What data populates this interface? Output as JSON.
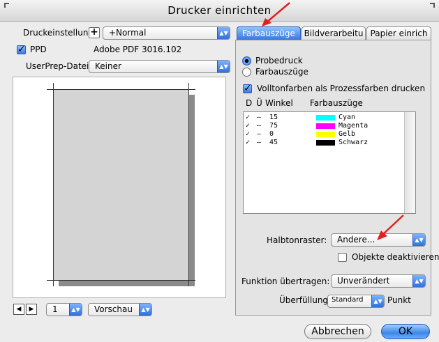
{
  "window": {
    "title": "Drucker einrichten"
  },
  "left": {
    "preset_label": "Druckeinstellung:",
    "preset_value": "+Normal",
    "ppd_label": "PPD",
    "ppd_value": "Adobe PDF 3016.102",
    "ppd_checked": true,
    "userprep_label": "UserPrep-Datei:",
    "userprep_value": "Keiner",
    "page_stepper": "1",
    "view_mode": "Vorschau"
  },
  "tabs": [
    {
      "label": "Farbauszüge",
      "active": true
    },
    {
      "label": "Bildverarbeitu",
      "active": false
    },
    {
      "label": "Papier einrich",
      "active": false
    }
  ],
  "separations": {
    "radio_proof": "Probedruck",
    "radio_separations": "Farbauszüge",
    "selected_radio": "Probedruck",
    "spot_to_process_label": "Volltonfarben als Prozessfarben drucken",
    "spot_to_process_checked": true,
    "col_d": "D",
    "col_u": "Ü",
    "col_angle": "Winkel",
    "col_name": "Farbauszüge",
    "plates": [
      {
        "check": "✓",
        "dash": "–",
        "angle": "15",
        "color": "#00ffff",
        "name": "Cyan"
      },
      {
        "check": "✓",
        "dash": "–",
        "angle": "75",
        "color": "#ff00ff",
        "name": "Magenta"
      },
      {
        "check": "✓",
        "dash": "–",
        "angle": "0",
        "color": "#ffff00",
        "name": "Gelb"
      },
      {
        "check": "✓",
        "dash": "–",
        "angle": "45",
        "color": "#000000",
        "name": "Schwarz"
      }
    ],
    "halftone_label": "Halbtonraster:",
    "halftone_value": "Andere...",
    "disable_objects_label": "Objekte deaktivieren",
    "transfer_label": "Funktion übertragen:",
    "transfer_value": "Unverändert",
    "trap_label": "Überfüllung:",
    "trap_value": "Standard",
    "trap_unit": "Punkt"
  },
  "buttons": {
    "cancel": "Abbrechen",
    "ok": "OK"
  },
  "colors": {
    "accent_blue": "#3877df",
    "annotation_red": "#e02020"
  }
}
